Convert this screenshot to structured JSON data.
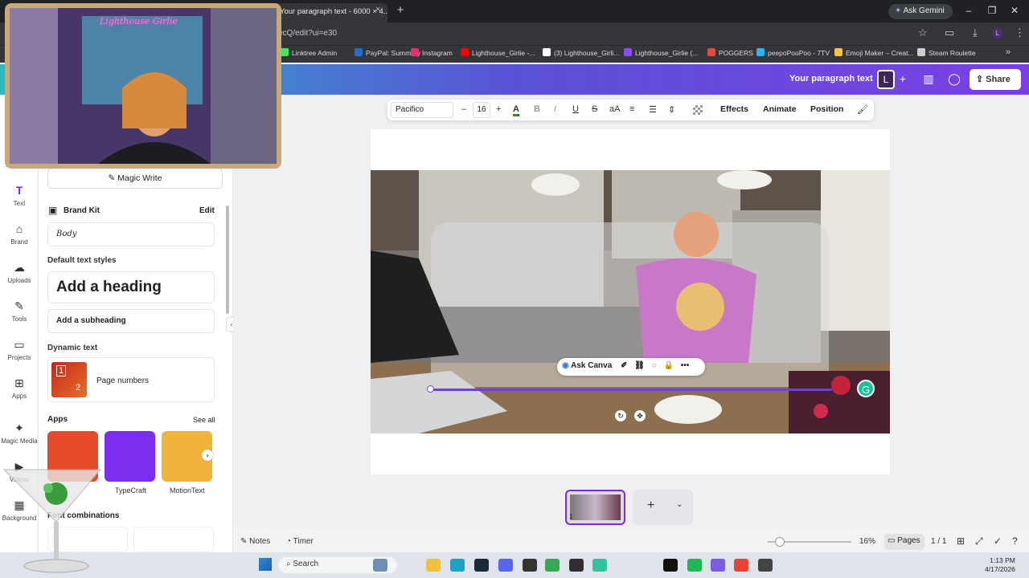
{
  "browser": {
    "tab_title": "Your paragraph text - 6000 × 4...",
    "tab_close": "×",
    "newtab": "+",
    "gemini": "Ask Gemini",
    "url": "ecQ/edit?ui=e30",
    "bookmarks": [
      {
        "label": "Linktree Admin",
        "color": "#43e660"
      },
      {
        "label": "PayPal: Summary",
        "color": "#1e6fd0"
      },
      {
        "label": "Instagram",
        "color": "#e1306c"
      },
      {
        "label": "Lighthouse_Girlie -...",
        "color": "#ff0000"
      },
      {
        "label": "(3) Lighthouse_Girli...",
        "color": "#ffffff"
      },
      {
        "label": "Lighthouse_Girlie (...",
        "color": "#9146ff"
      },
      {
        "label": "POGGERS",
        "color": "#e04a3f"
      },
      {
        "label": "peepoPooPoo - 7TV",
        "color": "#29b6f6"
      },
      {
        "label": "Emoji Maker – Creat...",
        "color": "#f6c445"
      },
      {
        "label": "Steam Roulette",
        "color": "#cccccc"
      }
    ]
  },
  "canva": {
    "doc_title": "Your paragraph text",
    "share": "Share",
    "avatar_letter": "L"
  },
  "rail": [
    {
      "label": "Text",
      "icon": "T"
    },
    {
      "label": "Brand",
      "icon": "⌂"
    },
    {
      "label": "Uploads",
      "icon": "☁"
    },
    {
      "label": "Tools",
      "icon": "✎"
    },
    {
      "label": "Projects",
      "icon": "▭"
    },
    {
      "label": "Apps",
      "icon": "⊞"
    },
    {
      "label": "Magic Media",
      "icon": "✦"
    },
    {
      "label": "Videos",
      "icon": "▶"
    },
    {
      "label": "Background",
      "icon": "▦"
    }
  ],
  "panel": {
    "magic_write": "Magic Write",
    "brand_kit": "Brand Kit",
    "edit": "Edit",
    "body": "Body",
    "default_styles": "Default text styles",
    "heading": "Add a heading",
    "subheading": "Add a subheading",
    "dynamic_text": "Dynamic text",
    "page_numbers": "Page numbers",
    "apps": "Apps",
    "see_all": "See all",
    "app_items": [
      {
        "label": "",
        "color": "#e54b2b"
      },
      {
        "label": "TypeCraft",
        "color": "#7a2ff0"
      },
      {
        "label": "MotionText",
        "color": "#f2b33d"
      }
    ],
    "font_combinations": "Font combinations",
    "thumb_num1": "1",
    "thumb_num2": "2"
  },
  "toolbar": {
    "font": "Pacifico",
    "size": "16",
    "minus": "–",
    "plus": "+",
    "effects": "Effects",
    "animate": "Animate",
    "position": "Position",
    "aA": "aA"
  },
  "ask_canva": "Ask Canva",
  "pages": {
    "thumb_num": "1",
    "add": "+"
  },
  "footer": {
    "notes": "Notes",
    "timer": "Timer",
    "zoom": "16%",
    "pages": "Pages",
    "page_count": "1 / 1"
  },
  "taskbar": {
    "search": "Search",
    "time": "1:13 PM",
    "date": "4/17/2026"
  },
  "webcam": {
    "neon": "Lighthouse Girlie"
  }
}
